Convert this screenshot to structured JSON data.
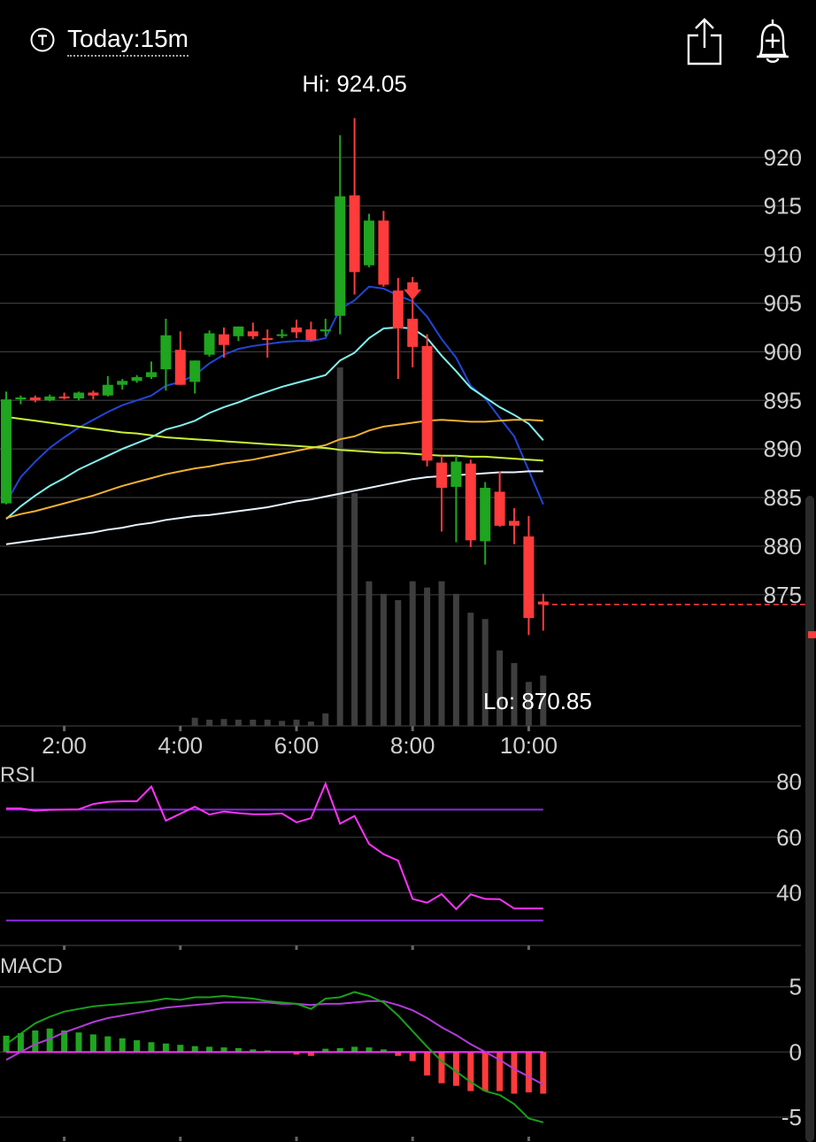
{
  "header": {
    "timeframe_label": "Today:15m",
    "icons": {
      "timeframe": "timeframe-t-icon",
      "share": "share-icon",
      "alert": "add-alert-bell-icon"
    }
  },
  "colors": {
    "up": "#1fa51f",
    "down": "#ff3b3b",
    "grid": "#3a3a3a",
    "axis_text": "#cfcfcf",
    "ma_blue": "#2046d8",
    "ma_cyan": "#7ff3ee",
    "ma_orange": "#f0b030",
    "ma_lime": "#c8f038",
    "ma_white": "#e6f4ff",
    "rsi": "#ff33ff",
    "rsi_bounds": "#8a2be2",
    "macd": "#18a018",
    "signal": "#b23bd8"
  },
  "chart_data": [
    {
      "type": "candlestick",
      "title": "",
      "hi_label": "Hi: 924.05",
      "lo_label": "Lo: 870.85",
      "y_ticks": [
        "920",
        "915",
        "910",
        "905",
        "900",
        "895",
        "890",
        "885",
        "880",
        "875"
      ],
      "x_ticks": [
        "2:00",
        "4:00",
        "6:00",
        "8:00",
        "10:00"
      ],
      "ylim": [
        861.5,
        928
      ],
      "last_price": 874.0,
      "candles": [
        {
          "o": 884.4,
          "h": 895.9,
          "l": 884.3,
          "c": 895.1
        },
        {
          "o": 895.1,
          "h": 895.5,
          "l": 894.6,
          "c": 895.3
        },
        {
          "o": 895.3,
          "h": 895.5,
          "l": 894.8,
          "c": 895.0
        },
        {
          "o": 895.0,
          "h": 895.6,
          "l": 894.9,
          "c": 895.4
        },
        {
          "o": 895.4,
          "h": 895.8,
          "l": 895.1,
          "c": 895.2
        },
        {
          "o": 895.2,
          "h": 895.9,
          "l": 895.0,
          "c": 895.8
        },
        {
          "o": 895.8,
          "h": 896.0,
          "l": 895.1,
          "c": 895.5
        },
        {
          "o": 895.5,
          "h": 897.5,
          "l": 895.4,
          "c": 896.6
        },
        {
          "o": 896.6,
          "h": 897.2,
          "l": 896.1,
          "c": 897.0
        },
        {
          "o": 897.0,
          "h": 897.6,
          "l": 896.8,
          "c": 897.4
        },
        {
          "o": 897.4,
          "h": 899.0,
          "l": 897.2,
          "c": 897.9
        },
        {
          "o": 898.2,
          "h": 903.4,
          "l": 896.0,
          "c": 901.7
        },
        {
          "o": 900.2,
          "h": 902.1,
          "l": 896.6,
          "c": 896.6
        },
        {
          "o": 896.9,
          "h": 899.1,
          "l": 895.7,
          "c": 899.1
        },
        {
          "o": 899.7,
          "h": 902.2,
          "l": 899.5,
          "c": 901.9
        },
        {
          "o": 901.8,
          "h": 902.5,
          "l": 899.4,
          "c": 900.7
        },
        {
          "o": 901.6,
          "h": 902.6,
          "l": 901.1,
          "c": 902.6
        },
        {
          "o": 902.1,
          "h": 903.0,
          "l": 901.3,
          "c": 901.6
        },
        {
          "o": 901.4,
          "h": 902.3,
          "l": 899.4,
          "c": 901.3
        },
        {
          "o": 901.8,
          "h": 902.3,
          "l": 901.4,
          "c": 901.8
        },
        {
          "o": 902.5,
          "h": 903.3,
          "l": 901.4,
          "c": 902.0
        },
        {
          "o": 902.3,
          "h": 903.1,
          "l": 901.1,
          "c": 901.2
        },
        {
          "o": 902.1,
          "h": 903.4,
          "l": 901.6,
          "c": 902.3
        },
        {
          "o": 903.7,
          "h": 922.3,
          "l": 901.8,
          "c": 916.0
        },
        {
          "o": 916.1,
          "h": 924.05,
          "l": 905.9,
          "c": 908.2
        },
        {
          "o": 908.9,
          "h": 914.2,
          "l": 908.7,
          "c": 913.5
        },
        {
          "o": 913.5,
          "h": 914.5,
          "l": 906.7,
          "c": 906.9
        },
        {
          "o": 906.3,
          "h": 907.6,
          "l": 897.2,
          "c": 902.4
        },
        {
          "o": 903.4,
          "h": 907.7,
          "l": 898.4,
          "c": 900.5
        },
        {
          "o": 900.6,
          "h": 901.8,
          "l": 888.2,
          "c": 888.8
        },
        {
          "o": 888.6,
          "h": 889.3,
          "l": 881.5,
          "c": 886.0
        },
        {
          "o": 886.1,
          "h": 889.3,
          "l": 880.4,
          "c": 888.7
        },
        {
          "o": 888.5,
          "h": 888.9,
          "l": 879.9,
          "c": 880.6
        },
        {
          "o": 880.5,
          "h": 886.6,
          "l": 878.1,
          "c": 886.0
        },
        {
          "o": 885.6,
          "h": 887.7,
          "l": 882.0,
          "c": 882.1
        },
        {
          "o": 882.6,
          "h": 883.9,
          "l": 880.2,
          "c": 882.1
        },
        {
          "o": 881.0,
          "h": 883.1,
          "l": 870.85,
          "c": 872.6
        },
        {
          "o": 874.3,
          "h": 875.1,
          "l": 871.3,
          "c": 874.0
        }
      ],
      "volume": [
        0,
        0,
        0,
        0,
        0,
        0,
        0,
        0,
        0,
        0,
        0,
        0,
        0,
        1.3,
        1.0,
        1.1,
        1.0,
        1.0,
        1.0,
        0.8,
        1.0,
        0.7,
        2.0,
        57,
        37,
        23,
        21,
        20,
        23,
        22,
        23,
        21,
        18,
        17,
        12,
        10,
        7,
        8
      ],
      "volume_max": 57,
      "moving_averages": [
        {
          "color": "ma_blue",
          "values": [
            884.5,
            887.1,
            888.7,
            890.1,
            891.2,
            892.2,
            893.0,
            893.8,
            894.5,
            895.0,
            895.5,
            896.5,
            896.9,
            897.6,
            898.8,
            899.7,
            900.3,
            900.6,
            900.8,
            901.0,
            901.1,
            901.1,
            901.4,
            904.4,
            905.3,
            906.7,
            906.5,
            905.8,
            905.2,
            903.6,
            901.3,
            899.4,
            896.5,
            895.2,
            893.2,
            891.3,
            887.8,
            884.3
          ]
        },
        {
          "color": "ma_cyan",
          "values": [
            882.8,
            884.1,
            885.2,
            886.2,
            887.0,
            887.9,
            888.6,
            889.3,
            890.0,
            890.6,
            891.2,
            892.0,
            892.4,
            892.9,
            893.7,
            894.3,
            894.8,
            895.4,
            895.9,
            896.4,
            896.8,
            897.2,
            897.6,
            899.1,
            899.9,
            901.4,
            902.4,
            902.5,
            902.4,
            901.4,
            899.6,
            898.0,
            896.3,
            895.3,
            894.3,
            893.5,
            892.6,
            890.9
          ]
        },
        {
          "color": "ma_orange",
          "values": [
            882.9,
            883.3,
            883.6,
            884.0,
            884.4,
            884.8,
            885.2,
            885.7,
            886.2,
            886.6,
            887.0,
            887.4,
            887.7,
            888.0,
            888.2,
            888.5,
            888.7,
            888.9,
            889.2,
            889.5,
            889.8,
            890.1,
            890.4,
            891.0,
            891.3,
            891.9,
            892.3,
            892.5,
            892.7,
            892.9,
            893.0,
            892.9,
            892.8,
            892.8,
            892.9,
            893.0,
            893.0,
            892.9
          ]
        },
        {
          "color": "ma_lime",
          "values": [
            893.3,
            893.1,
            892.9,
            892.7,
            892.5,
            892.3,
            892.1,
            891.9,
            891.7,
            891.6,
            891.4,
            891.2,
            891.1,
            891.0,
            890.9,
            890.8,
            890.7,
            890.6,
            890.5,
            890.4,
            890.3,
            890.2,
            890.1,
            889.9,
            889.8,
            889.7,
            889.6,
            889.6,
            889.5,
            889.4,
            889.3,
            889.3,
            889.2,
            889.2,
            889.1,
            889.0,
            888.9,
            888.8
          ]
        },
        {
          "color": "ma_white",
          "values": [
            880.2,
            880.4,
            880.6,
            880.8,
            881.0,
            881.2,
            881.4,
            881.7,
            881.9,
            882.2,
            882.4,
            882.7,
            882.9,
            883.1,
            883.2,
            883.4,
            883.6,
            883.8,
            884.0,
            884.3,
            884.6,
            884.8,
            885.1,
            885.4,
            885.7,
            886.0,
            886.3,
            886.6,
            886.9,
            887.1,
            887.2,
            887.3,
            887.4,
            887.5,
            887.6,
            887.6,
            887.7,
            887.7
          ]
        }
      ],
      "signal_arrow_index": 28
    },
    {
      "type": "line",
      "title": "RSI",
      "y_ticks": [
        "80",
        "60",
        "40"
      ],
      "ylim": [
        21,
        81
      ],
      "bounds": [
        70,
        30
      ],
      "values": [
        70.4,
        70.4,
        69.6,
        69.9,
        70.0,
        70.1,
        72.0,
        72.8,
        73.0,
        73.0,
        78.3,
        66.0,
        68.5,
        71.0,
        68.2,
        69.3,
        68.7,
        68.3,
        68.3,
        68.6,
        65.4,
        66.9,
        79.3,
        64.9,
        67.7,
        57.6,
        53.9,
        51.6,
        37.8,
        36.4,
        39.5,
        34.1,
        39.4,
        37.8,
        37.7,
        34.3,
        34.3,
        34.3
      ]
    },
    {
      "type": "bar+line",
      "title": "MACD",
      "y_ticks": [
        "5",
        "0",
        "-5"
      ],
      "ylim": [
        -6.5,
        6.0
      ],
      "histogram": [
        1.25,
        1.45,
        1.65,
        1.8,
        1.65,
        1.5,
        1.35,
        1.2,
        1.05,
        0.9,
        0.75,
        0.65,
        0.55,
        0.45,
        0.4,
        0.35,
        0.3,
        0.2,
        0.12,
        0.05,
        -0.2,
        -0.3,
        0.25,
        0.3,
        0.4,
        0.35,
        0.2,
        -0.3,
        -0.7,
        -1.8,
        -2.4,
        -2.6,
        -3.0,
        -3.0,
        -3.0,
        -3.2,
        -3.1,
        -3.2
      ],
      "macd": [
        0.6,
        1.4,
        2.2,
        2.7,
        3.1,
        3.3,
        3.5,
        3.6,
        3.7,
        3.8,
        3.9,
        4.1,
        4.0,
        4.2,
        4.2,
        4.3,
        4.2,
        4.1,
        3.9,
        3.8,
        3.7,
        3.3,
        4.1,
        4.2,
        4.6,
        4.3,
        3.8,
        2.8,
        1.6,
        0.4,
        -0.7,
        -1.5,
        -2.3,
        -3.0,
        -3.3,
        -4.0,
        -5.1,
        -5.4
      ],
      "signal": [
        -0.6,
        0.0,
        0.6,
        1.0,
        1.5,
        1.9,
        2.3,
        2.6,
        2.8,
        3.0,
        3.2,
        3.4,
        3.5,
        3.6,
        3.7,
        3.8,
        3.8,
        3.8,
        3.8,
        3.7,
        3.7,
        3.6,
        3.7,
        3.7,
        3.8,
        3.9,
        3.9,
        3.6,
        3.2,
        2.6,
        1.9,
        1.3,
        0.6,
        0.0,
        -0.6,
        -1.3,
        -1.9,
        -2.5
      ]
    }
  ]
}
